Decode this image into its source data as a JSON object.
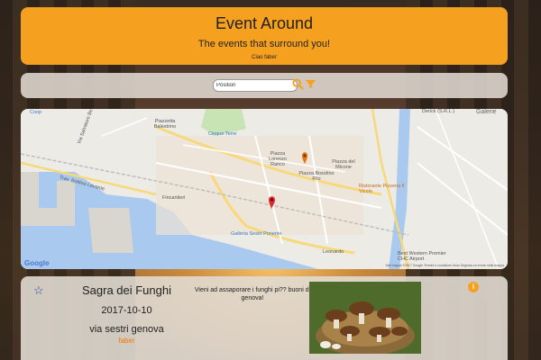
{
  "header": {
    "title": "Event Around",
    "subtitle": "The events that surround you!",
    "greeting": "Ciao faber"
  },
  "search": {
    "value": "Position",
    "search_icon": "search-icon",
    "filter_icon": "filter-icon"
  },
  "map": {
    "labels": [
      "Coop",
      "Piazzetta Balestrino",
      "Cinque Terre",
      "Via Salvatore Bevilacqua",
      "Trav. Bottino Levante",
      "Piazza Lorenzo Ranco",
      "Piazza del Micone",
      "Piazza Bosolino Pilo",
      "Fincantieri",
      "Ristorante Pizzeria Il Vicolo",
      "Galleria Sestri Ponente",
      "Leonardo",
      "Best Western Premier CHC Airport",
      "Derick (S.R.L.)",
      "Galerie"
    ],
    "google_logo": "Google",
    "attribution": "Dati mappa ©2017 Google   Termini e condizioni d'uso   Segnala un errore nella mappa",
    "marker_colors": [
      "#e8730c",
      "#d32f2f"
    ]
  },
  "event": {
    "name": "Sagra dei Funghi",
    "date": "2017-10-10",
    "place": "via sestri genova",
    "author": "faber",
    "description": "Vieni ad assaporare i funghi pi?? buoni di genova!",
    "star_icon": "star-outline-icon",
    "info_icon": "info-icon",
    "info_glyph": "i"
  },
  "colors": {
    "accent": "#f5a11f",
    "author": "#f07a00",
    "star": "#2a47a8"
  }
}
